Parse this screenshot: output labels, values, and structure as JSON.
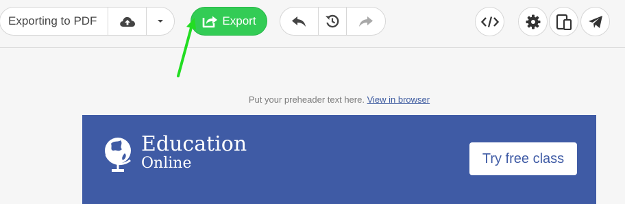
{
  "toolbar": {
    "document_name": "Exporting to PDF",
    "export_label": "Export",
    "icons": {
      "save": "cloud-upload-icon",
      "more": "caret-down-icon",
      "export": "share-square-icon",
      "undo": "reply-icon",
      "history": "history-icon",
      "redo": "redo-icon",
      "code": "code-icon",
      "settings": "gear-icon",
      "preview": "mobile-tablet-icon",
      "send": "paper-plane-icon"
    }
  },
  "email": {
    "preheader_text": "Put your preheader text here.",
    "view_in_browser": "View in browser",
    "logo_line1": "Education",
    "logo_line2": "Online",
    "cta_label": "Try free class"
  },
  "colors": {
    "export_green": "#33cc55",
    "banner_blue": "#3f5ba5",
    "annotation_green": "#22dd22"
  }
}
